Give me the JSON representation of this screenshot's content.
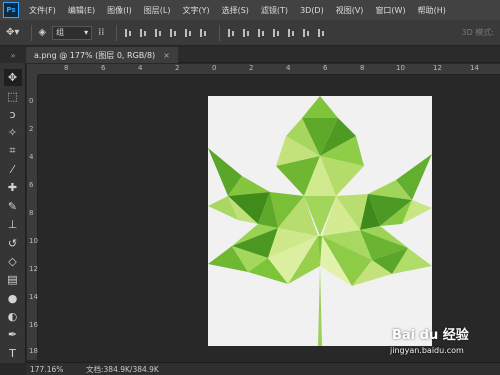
{
  "menubar": {
    "logo": "Ps",
    "items": [
      "文件(F)",
      "编辑(E)",
      "图像(I)",
      "图层(L)",
      "文字(Y)",
      "选择(S)",
      "滤镜(T)",
      "3D(D)",
      "视图(V)",
      "窗口(W)",
      "帮助(H)"
    ]
  },
  "optbar": {
    "select_value": "组",
    "mode3d_label": "3D 模式:"
  },
  "document": {
    "tab_label": "a.png @ 177% (图层 0, RGB/8)",
    "close_glyph": "×"
  },
  "rulers": {
    "horizontal": [
      "8",
      "6",
      "4",
      "2",
      "0",
      "2",
      "4",
      "6",
      "8",
      "10",
      "12",
      "14"
    ],
    "vertical": [
      "0",
      "2",
      "4",
      "6",
      "8",
      "10",
      "12",
      "14",
      "16",
      "18"
    ]
  },
  "statusbar": {
    "zoom": "177.16%",
    "doc_info": "文档:384.9K/384.9K"
  },
  "watermark": {
    "brand": "Bai du 经验",
    "url": "jingyan.baidu.com"
  },
  "colors": {
    "accent": "#31a8ff",
    "leaf_dark": "#4a9a1c",
    "leaf_light": "#b8e070"
  }
}
